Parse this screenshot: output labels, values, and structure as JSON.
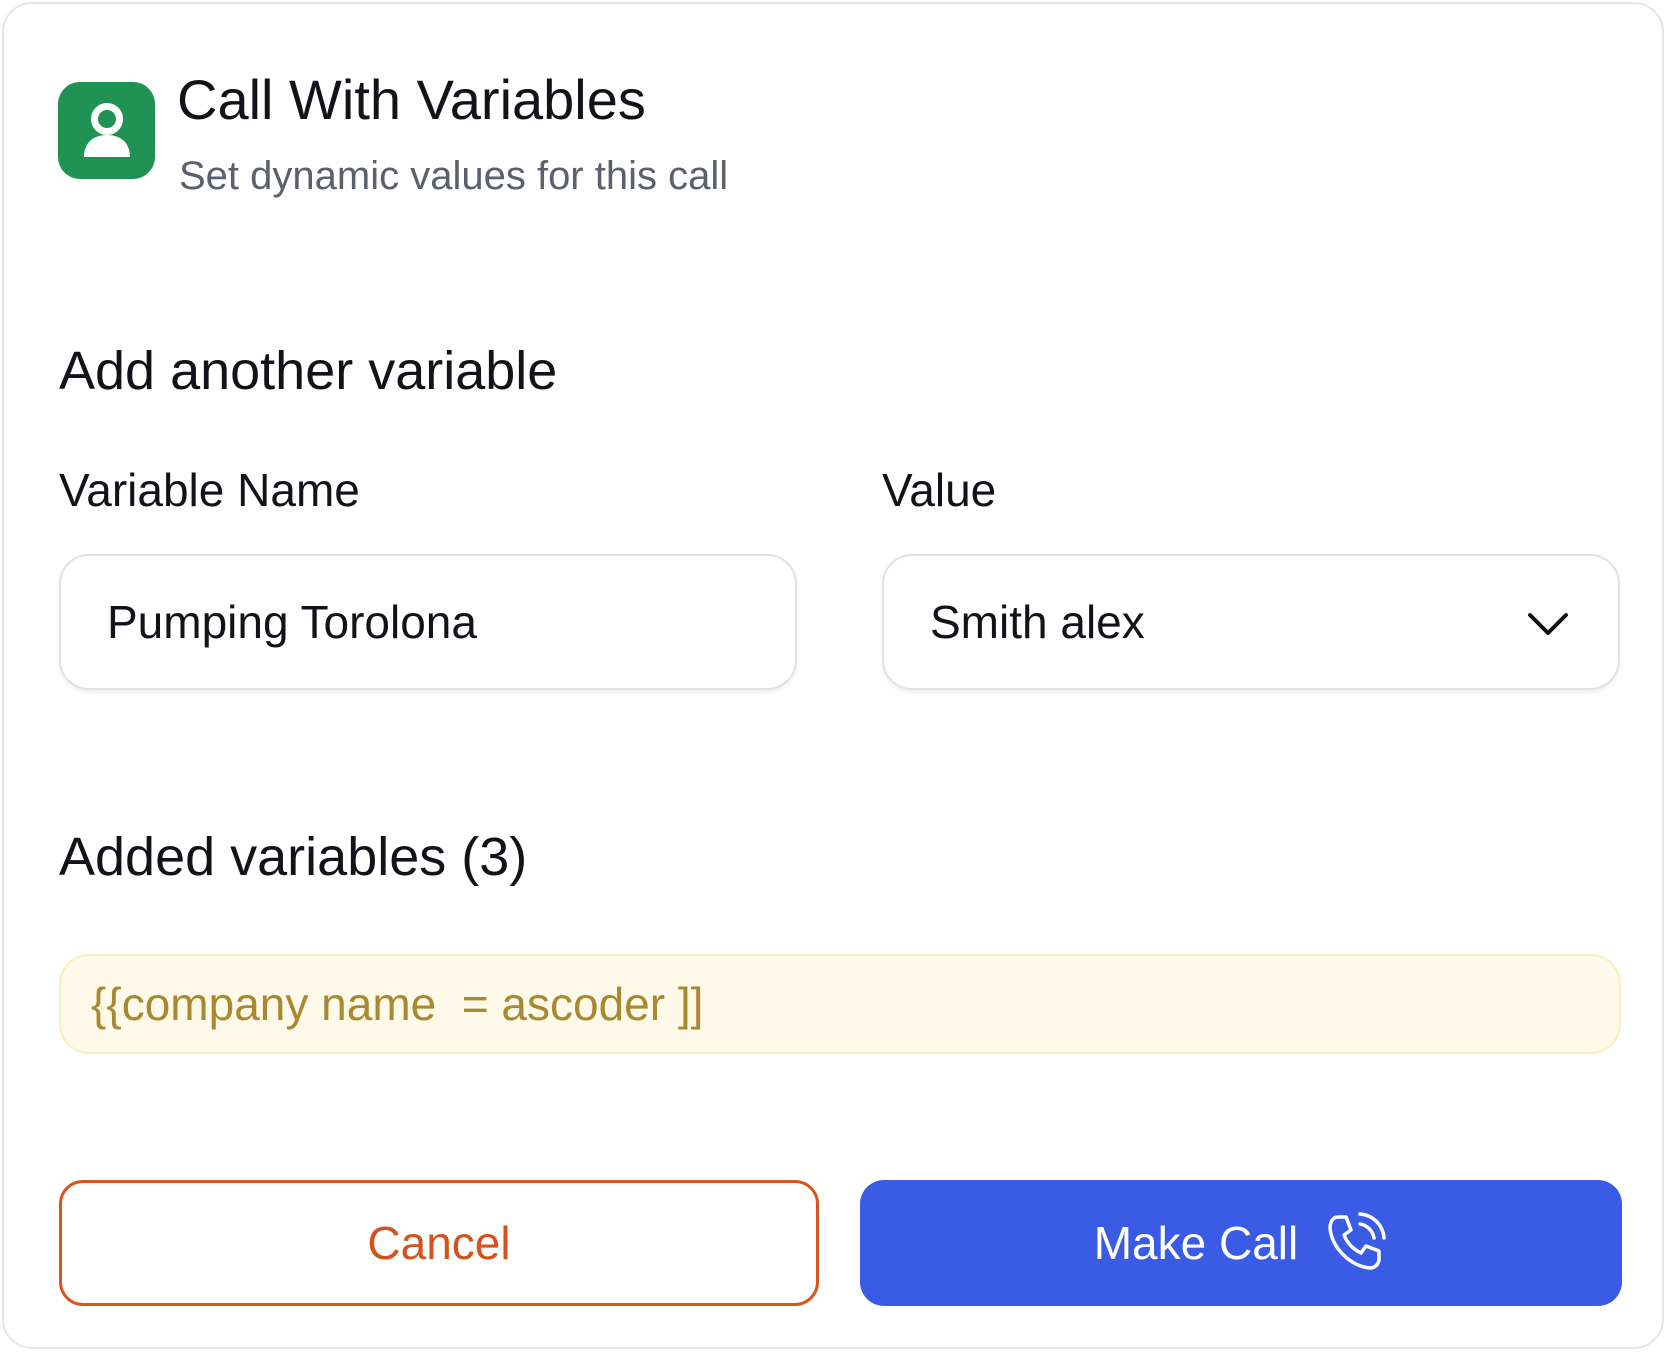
{
  "header": {
    "title": "Call With Variables",
    "subtitle": "Set dynamic values for this call",
    "icon": "user-icon",
    "icon_color": "#1f9254"
  },
  "add_variable": {
    "heading": "Add another variable",
    "name_label": "Variable Name",
    "name_value": "Pumping Torolona",
    "value_label": "Value",
    "value_selected": "Smith alex",
    "value_icon": "chevron-down-icon"
  },
  "added_variables": {
    "heading": "Added variables (3)",
    "items": [
      {
        "text": "{{company name  = ascoder ]]"
      }
    ],
    "chip_background": "#fef9e9",
    "chip_text_color": "#a8892f"
  },
  "actions": {
    "cancel_label": "Cancel",
    "cancel_color": "#d4531b",
    "call_label": "Make Call",
    "call_icon": "phone-calling-icon",
    "call_color": "#3a5ce5"
  }
}
